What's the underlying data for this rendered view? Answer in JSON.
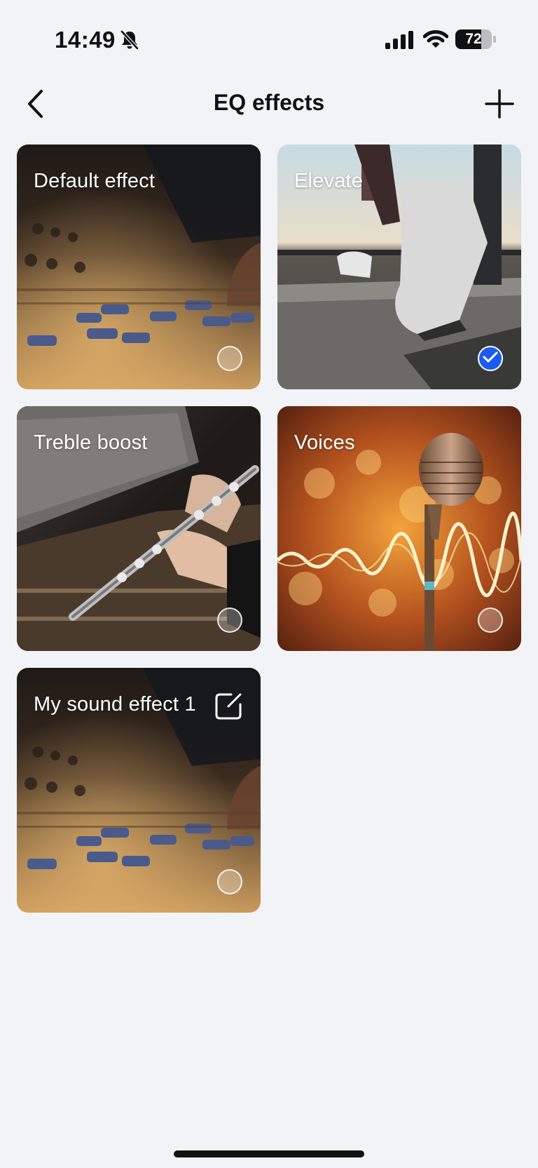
{
  "status_bar": {
    "time": "14:49",
    "battery_percent": 72,
    "battery_label": "72",
    "icons": [
      "bell-slash-icon",
      "signal-bars-icon",
      "wifi-icon",
      "battery-icon"
    ]
  },
  "header": {
    "title": "EQ effects",
    "back_icon": "chevron-left-icon",
    "add_icon": "plus-icon"
  },
  "effects": [
    {
      "label": "Default effect",
      "selected": false,
      "editable": false,
      "art": "mixing-console"
    },
    {
      "label": "Elevate",
      "selected": true,
      "editable": false,
      "art": "running-shoe-treadmill"
    },
    {
      "label": "Treble boost",
      "selected": false,
      "editable": false,
      "art": "flute-player"
    },
    {
      "label": "Voices",
      "selected": false,
      "editable": false,
      "art": "vintage-microphone"
    },
    {
      "label": "My sound effect 1",
      "selected": false,
      "editable": true,
      "art": "mixing-console"
    }
  ],
  "colors": {
    "background": "#f2f3f7",
    "selected_accent": "#1a5cf0"
  }
}
